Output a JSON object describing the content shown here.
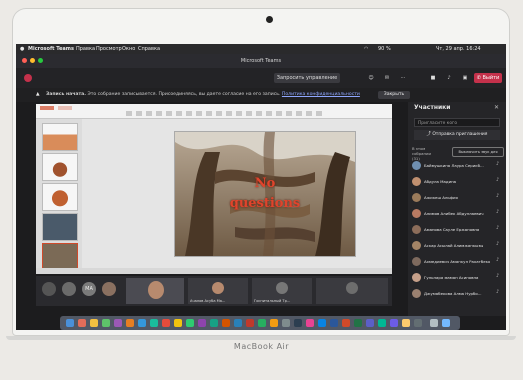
{
  "menubar": {
    "app": "Microsoft Teams",
    "items": [
      "Правка",
      "Просмотр",
      "Окно",
      "Справка"
    ],
    "battery": "90 %",
    "datetime": "Чт, 29 апр. 16:24"
  },
  "window": {
    "title": "Microsoft Teams"
  },
  "toolbar": {
    "request_control": "Запросить управление",
    "leave_label": "Выйти"
  },
  "banner": {
    "title": "Запись начата.",
    "text": "Это собрание записывается. Присоединяясь, вы даете согласие на его запись.",
    "link": "Политика конфиденциальности",
    "close_button": "Закрыть"
  },
  "slide": {
    "line1": "No",
    "line2": "questions"
  },
  "strip": {
    "bubbles": [
      "",
      "",
      "МА",
      ""
    ],
    "tiles": [
      "",
      "Ачалов Асуба Ма...",
      "Госпитальный Тр..."
    ]
  },
  "panel": {
    "title": "Участники",
    "search_placeholder": "Пригласите кого",
    "invite_button": "Отправка приглашения",
    "section_label": "В этом собрании (31)",
    "mute_all_button": "Выключить звук для",
    "participants": [
      "Баймушкина Лаура Серикб...",
      "Абдула Мадина",
      "Ажикеш Альфия",
      "Алимов Алибек Абдуллаевич",
      "Аманова Сауле Ержановна",
      "Аскар Асылай Алимжанкызы",
      "Ахмедиевич Аманкул Рахатбекович",
      "Гульнара маман Асиновна",
      "Джумабекова Алма Нурбо..."
    ]
  },
  "laptop_brand": "MacBook Air"
}
